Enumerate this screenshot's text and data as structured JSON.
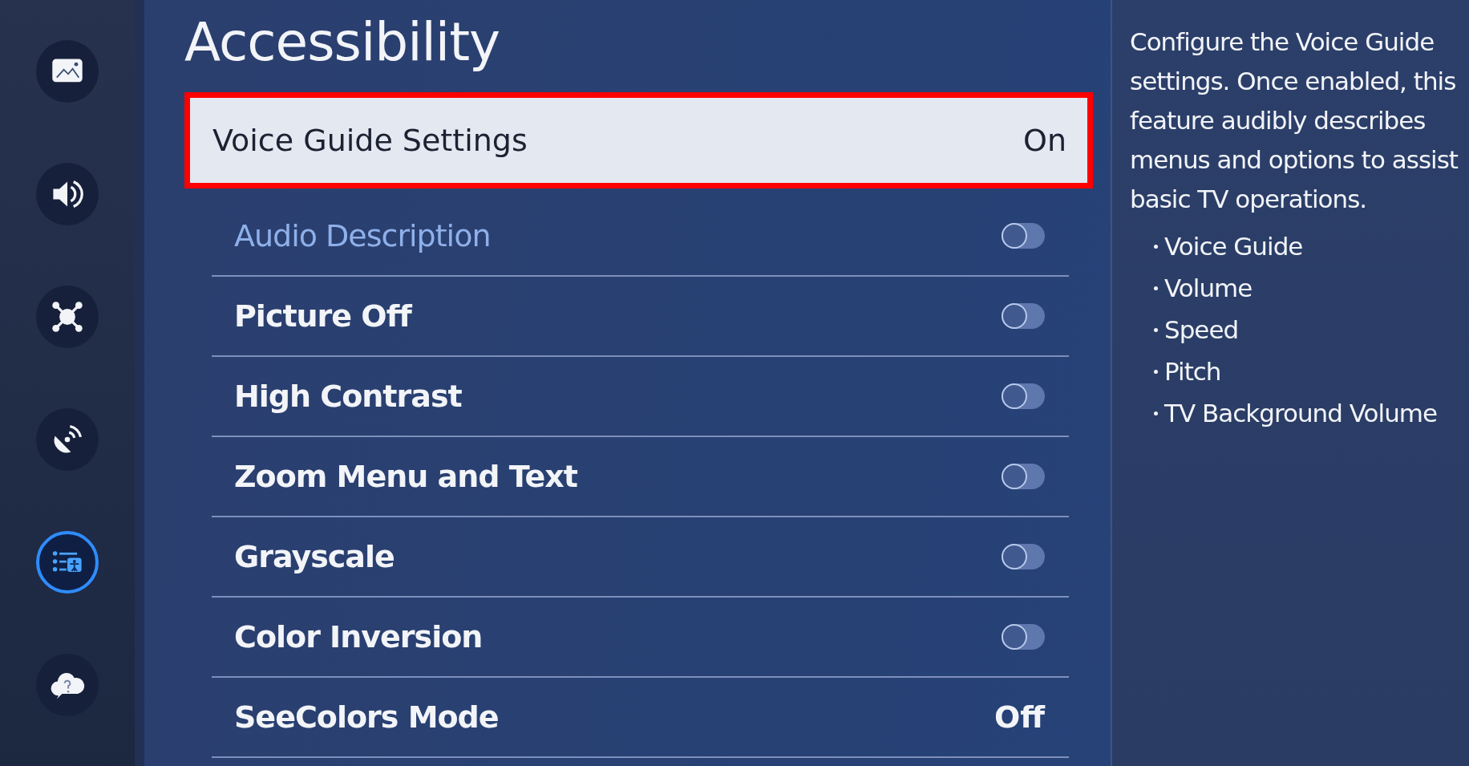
{
  "sidebar": {
    "items": [
      {
        "kind": "picture",
        "selected": false
      },
      {
        "kind": "sound",
        "selected": false
      },
      {
        "kind": "connection",
        "selected": false
      },
      {
        "kind": "broadcast",
        "selected": false
      },
      {
        "kind": "accessibility",
        "selected": true
      },
      {
        "kind": "support",
        "selected": false
      }
    ]
  },
  "title": "Accessibility",
  "menu": [
    {
      "kind": "value",
      "label": "Voice Guide Settings",
      "value": "On",
      "selected": true,
      "disabled": false
    },
    {
      "kind": "toggle",
      "label": "Audio Description",
      "on": false,
      "selected": false,
      "disabled": true
    },
    {
      "kind": "toggle",
      "label": "Picture Off",
      "on": false,
      "selected": false,
      "disabled": false
    },
    {
      "kind": "toggle",
      "label": "High Contrast",
      "on": false,
      "selected": false,
      "disabled": false
    },
    {
      "kind": "toggle",
      "label": "Zoom Menu and Text",
      "on": false,
      "selected": false,
      "disabled": false
    },
    {
      "kind": "toggle",
      "label": "Grayscale",
      "on": false,
      "selected": false,
      "disabled": false
    },
    {
      "kind": "toggle",
      "label": "Color Inversion",
      "on": false,
      "selected": false,
      "disabled": false
    },
    {
      "kind": "value",
      "label": "SeeColors Mode",
      "value": "Off",
      "selected": false,
      "disabled": false
    }
  ],
  "info": {
    "description": "Configure the Voice Guide settings. Once enabled, this feature audibly describes menus and options to assist basic TV operations.",
    "bullets": [
      "Voice Guide",
      "Volume",
      "Speed",
      "Pitch",
      "TV Background Volume"
    ]
  }
}
